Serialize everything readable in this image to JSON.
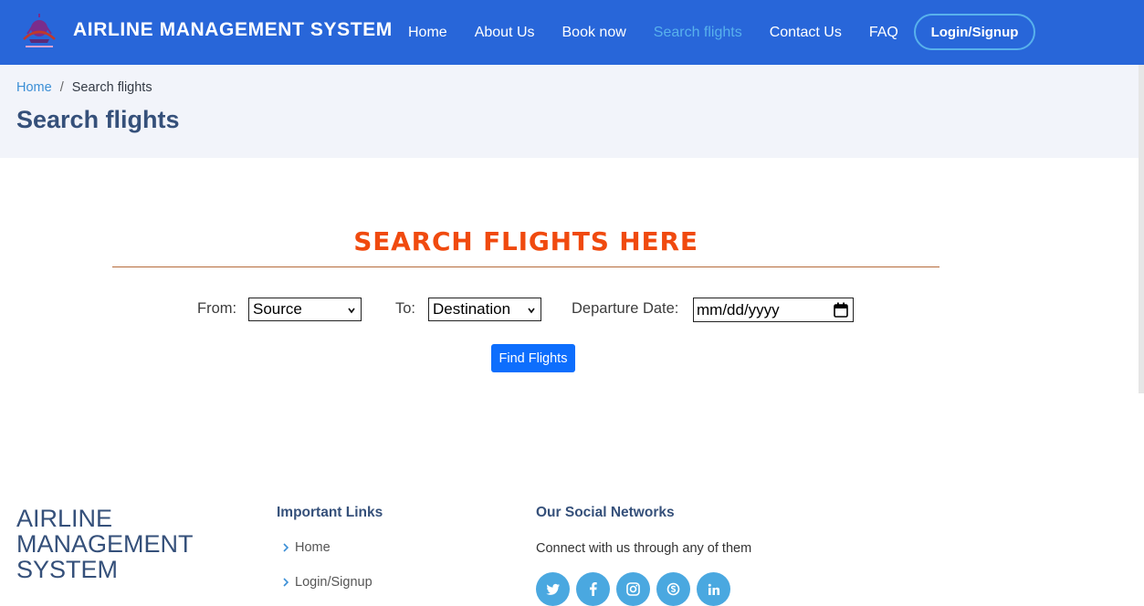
{
  "header": {
    "brand": "AIRLINE MANAGEMENT SYSTEM",
    "nav": [
      "Home",
      "About Us",
      "Book now",
      "Search flights",
      "Contact Us",
      "FAQ"
    ],
    "active_nav": "Search flights",
    "login_label": "Login/Signup",
    "colors": {
      "bar": "#2866d9",
      "active": "#58b1ec"
    }
  },
  "breadcrumb": {
    "home": "Home",
    "sep": "/",
    "current": "Search flights"
  },
  "page_title": "Search flights",
  "search": {
    "heading": "SEARCH FLIGHTS HERE",
    "from_label": "From:",
    "from_value": "Source",
    "to_label": "To:",
    "to_value": "Destination",
    "date_label": "Departure Date:",
    "date_value": "mm/dd/yyyy",
    "button": "Find Flights",
    "colors": {
      "heading": "#f04a0f",
      "button": "#0d6efd"
    }
  },
  "footer": {
    "brand_lines": [
      "AIRLINE",
      "MANAGEMENT",
      "SYSTEM"
    ],
    "links_title": "Important Links",
    "links": [
      "Home",
      "Login/Signup"
    ],
    "social_title": "Our Social Networks",
    "social_text": "Connect with us through any of them",
    "social_icons": [
      "twitter-icon",
      "facebook-icon",
      "instagram-icon",
      "skype-icon",
      "linkedin-icon"
    ]
  }
}
